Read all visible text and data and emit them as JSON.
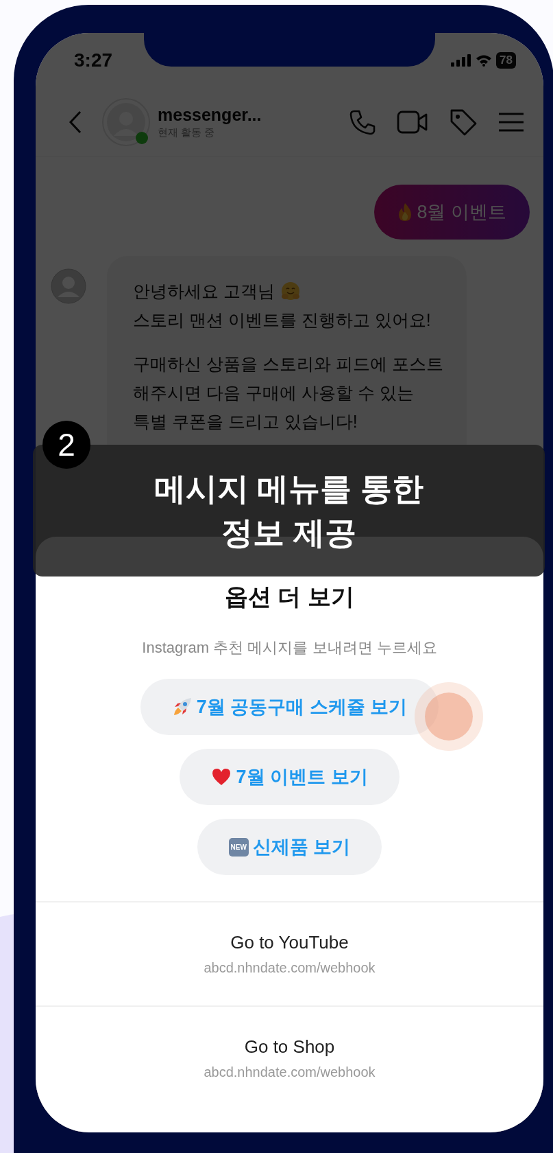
{
  "status_bar": {
    "time": "3:27",
    "battery": "78"
  },
  "chat_header": {
    "name": "messenger...",
    "status": "현재 활동 중",
    "online": true
  },
  "messages": [
    {
      "kind": "sent",
      "text": "8월 이벤트"
    },
    {
      "kind": "received",
      "paragraphs": [
        {
          "lines": [
            "안녕하세요 고객님",
            "스토리 맨션 이벤트를 진행하고 있어요!"
          ]
        },
        {
          "lines": [
            "구매하신 상품을 스토리와 피드에 포스트",
            "해주시면 다음 구매에 사용할 수 있는",
            "특별 쿠폰을 드리고 있습니다!"
          ]
        }
      ]
    }
  ],
  "caption": {
    "number": "2",
    "title_lines": [
      "메시지 메뉴를 통한",
      "정보 제공"
    ]
  },
  "sheet": {
    "title": "옵션 더 보기",
    "subtitle": "Instagram 추천 메시지를 보내려면 누르세요",
    "quick_replies": [
      {
        "label": "7월 공동구매 스케쥴 보기",
        "pressed": true
      },
      {
        "label": "7월 이벤트 보기",
        "pressed": false
      },
      {
        "icon_text": "NEW",
        "label": "신제품 보기",
        "pressed": false
      }
    ],
    "links": [
      {
        "title": "Go to YouTube",
        "url": "abcd.nhndate.com/webhook"
      },
      {
        "title": "Go to Shop",
        "url": "abcd.nhndate.com/webhook"
      }
    ]
  }
}
